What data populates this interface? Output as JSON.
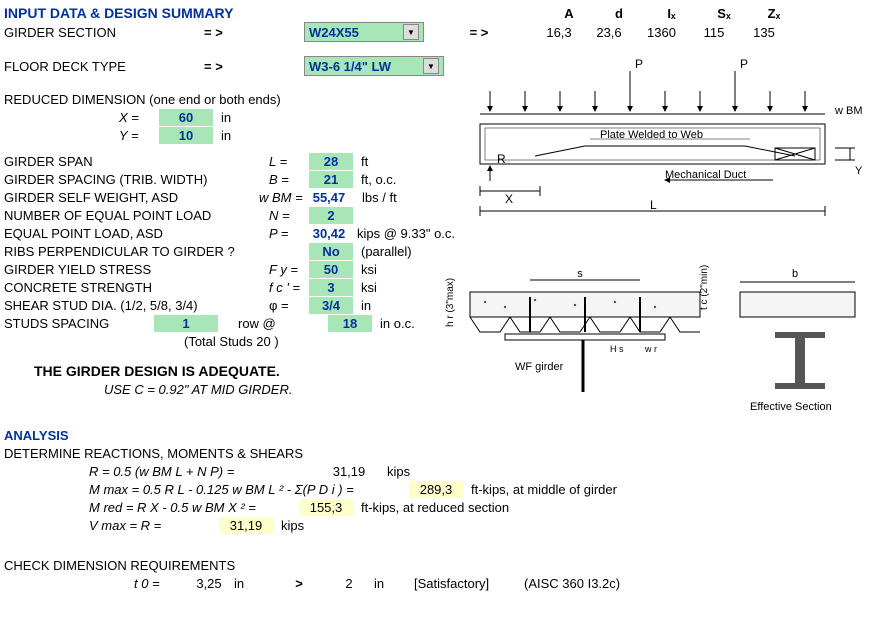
{
  "title": "INPUT DATA & DESIGN SUMMARY",
  "girder_section": {
    "label": "GIRDER SECTION",
    "arrow": "= >",
    "value": "W24X55",
    "arrow2": "= >",
    "props": {
      "A": "16,3",
      "d": "23,6",
      "Ix": "1360",
      "Sx": "115",
      "Zx": "135"
    },
    "headers": {
      "A": "A",
      "d": "d",
      "Ix": "Iₓ",
      "Sx": "Sₓ",
      "Zx": "Zₓ"
    }
  },
  "floor_deck": {
    "label": "FLOOR DECK TYPE",
    "arrow": "= >",
    "value": "W3-6 1/4\" LW"
  },
  "reduced_dim": {
    "label": "REDUCED DIMENSION (one end or both ends)",
    "X": {
      "sym": "X =",
      "val": "60",
      "unit": "in"
    },
    "Y": {
      "sym": "Y =",
      "val": "10",
      "unit": "in"
    }
  },
  "params": {
    "span": {
      "label": "GIRDER SPAN",
      "sym": "L =",
      "val": "28",
      "unit": "ft"
    },
    "spacing": {
      "label": "GIRDER SPACING (TRIB. WIDTH)",
      "sym": "B =",
      "val": "21",
      "unit": "ft, o.c."
    },
    "selfwt": {
      "label": "GIRDER SELF WEIGHT, ASD",
      "sym": "w BM =",
      "val": "55,47",
      "unit": "lbs / ft"
    },
    "npt": {
      "label": "NUMBER OF EQUAL POINT LOAD",
      "sym": "N =",
      "val": "2",
      "unit": ""
    },
    "ptload": {
      "label": "EQUAL POINT LOAD, ASD",
      "sym": "P =",
      "val": "30,42",
      "unit": "kips @ 9.33\" o.c."
    },
    "ribs": {
      "label": "RIBS PERPENDICULAR TO GIRDER ?",
      "sym": "",
      "val": "No",
      "unit": "(parallel)"
    },
    "fy": {
      "label": "GIRDER YIELD STRESS",
      "sym": "F y =",
      "val": "50",
      "unit": "ksi"
    },
    "fc": {
      "label": "CONCRETE STRENGTH",
      "sym": "f c ' =",
      "val": "3",
      "unit": "ksi"
    },
    "stud": {
      "label": "SHEAR STUD DIA. (1/2, 5/8, 3/4)",
      "sym": "φ =",
      "val": "3/4",
      "unit": "in"
    },
    "studsp": {
      "label": "STUDS SPACING",
      "val1": "1",
      "mid": "row @",
      "val2": "18",
      "unit": "in o.c."
    },
    "totalstuds": "(Total Studs 20 )"
  },
  "result": {
    "line1": "THE GIRDER DESIGN IS ADEQUATE.",
    "line2": "USE C = 0.92\" AT MID GIRDER."
  },
  "analysis": {
    "title": "ANALYSIS",
    "sub1": "DETERMINE REACTIONS,  MOMENTS & SHEARS",
    "R": {
      "formula": "R  = 0.5 (w BM  L + N P) =",
      "val": "31,19",
      "unit": "kips"
    },
    "Mmax": {
      "formula": "M max   = 0.5 R L - 0.125 w BM L ² -  Σ(P  D i ) =",
      "val": "289,3",
      "unit": "ft-kips, at middle of girder"
    },
    "Mred": {
      "formula": "M red   = R X - 0.5 w BM X ² =",
      "val": "155,3",
      "unit": "ft-kips, at reduced section"
    },
    "Vmax": {
      "formula": "V max   = R =",
      "val": "31,19",
      "unit": "kips"
    }
  },
  "check": {
    "title": "CHECK DIMENSION REQUIREMENTS",
    "t0": {
      "sym": "t 0   =",
      "v1": "3,25",
      "u1": "in",
      "op": ">",
      "v2": "2",
      "u2": "in",
      "status": "[Satisfactory]",
      "ref": "(AISC 360 I3.2c)"
    }
  },
  "diag1": {
    "P": "P",
    "wbm": "w BM",
    "R": "R",
    "X": "X",
    "L": "L",
    "plate": "Plate Welded to Web",
    "duct": "Mechanical Duct",
    "Y": "Y"
  },
  "diag2": {
    "s": "s",
    "b": "b",
    "hr": "h r  (3\"max)",
    "tc": "t c  (2\"min)",
    "hs": "H s",
    "wr": "w r",
    "wf": "WF  girder",
    "eff": "Effective  Section"
  }
}
